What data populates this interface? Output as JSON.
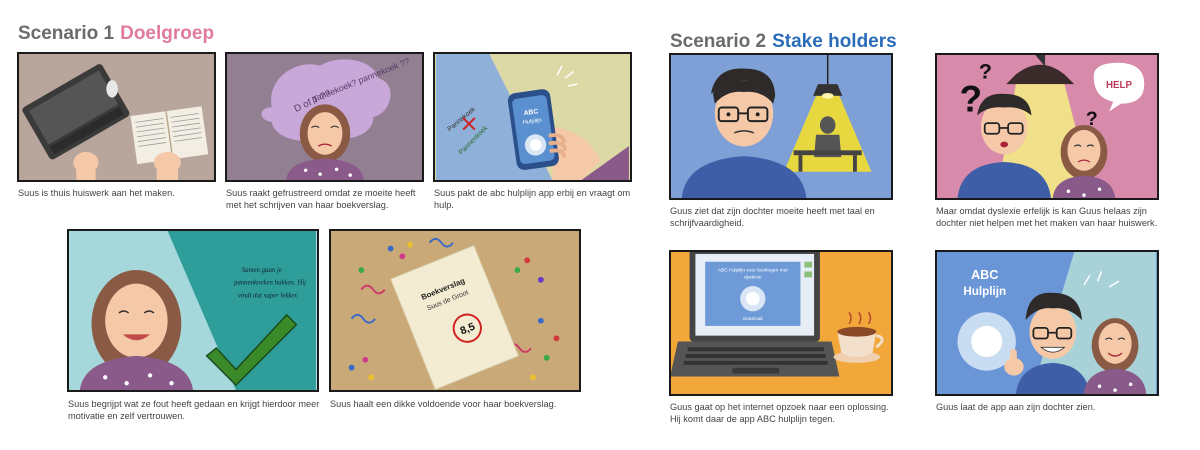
{
  "scenario1": {
    "title_number": "Scenario 1",
    "title_label": "Doelgroep",
    "label_color": "#e07aa0",
    "captions": [
      "Suus is thuis huiswerk aan het maken.",
      "Suus raakt gefrustreerd omdat ze moeite heeft met het schrijven van haar boekverslag.",
      "Suus pakt de abc hulplijn app erbij en vraagt om hulp.",
      "Suus begrijpt wat ze fout heeft gedaan en krijgt hierdoor meer motivatie en zelf vertrouwen.",
      "Suus haalt een dikke voldoende voor haar boekverslag."
    ]
  },
  "scenario2": {
    "title_number": "Scenario 2",
    "title_label": "Stake holders",
    "label_color": "#2b6cb8",
    "captions": [
      "Guus ziet dat zijn dochter moeite heeft met taal en schrijfvaardigheid.",
      "Maar omdat dyslexie erfelijk is kan Guus helaas zijn dochter niet helpen met het maken van haar huiswerk.",
      "Guus gaat op het internet opzoek naar een oplossing. Hij komt daar de app ABC hulplijn tegen.",
      "Guus laat de app aan zijn dochter zien."
    ]
  },
  "panel_texts": {
    "p2_bubble_1": "pannekoek? pannekoek ??",
    "p2_bubble_2": "D of T ??",
    "p2_small": "Dt",
    "p3_app_line1": "ABC",
    "p3_app_line2": "Hulplijn",
    "p3_word_wrong": "Pannekoek",
    "p3_word_right": "Pannenkoek",
    "p4_note_1": "Samen gaan je",
    "p4_note_2": "pannenkoeken bakken. Hij",
    "p4_note_3": "vindt dat super lekker.",
    "p5_doc_title": "Boekverslag",
    "p5_doc_author": "Suus de Groot",
    "p5_grade": "8,5",
    "p7_help": "HELP",
    "p7_q1": "?",
    "p7_q2": "?",
    "p7_q3": "?",
    "p8_screen_title_1": "ABC Hulplijn voor leerlingen met",
    "p8_screen_title_2": "dyslexie",
    "p8_download": "Download",
    "p9_app_line1": "ABC",
    "p9_app_line2": "Hulplijn"
  },
  "colors": {
    "panel_border": "#1a1a1a",
    "skin": "#f5c9a8",
    "hair_girl": "#8a5a44",
    "hair_dad": "#2e2a2a",
    "shirt_girl": "#8a5a8a",
    "shirt_dad": "#3f5ea8"
  }
}
